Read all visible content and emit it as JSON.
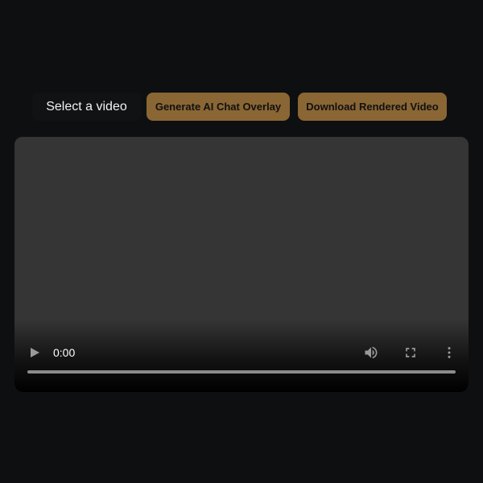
{
  "toolbar": {
    "file_select_label": "Select a video",
    "generate_label": "Generate AI Chat Overlay",
    "download_label": "Download Rendered Video"
  },
  "player": {
    "current_time": "0:00",
    "progress": 0,
    "icons": {
      "play": "play-icon",
      "volume": "volume-icon",
      "fullscreen": "fullscreen-icon",
      "menu": "more-vert-icon"
    }
  },
  "colors": {
    "background": "#0e0f11",
    "button": "#8a6634",
    "button_text": "#111111",
    "video_surface": "#353535"
  }
}
